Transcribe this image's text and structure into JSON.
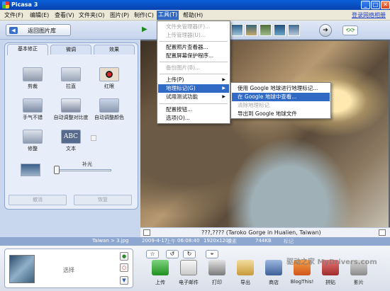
{
  "window": {
    "title": "Picasa 3",
    "minimize": "_",
    "maximize": "□",
    "close": "✕"
  },
  "menubar": {
    "items": [
      "文件(F)",
      "编辑(E)",
      "查看(V)",
      "文件夹(O)",
      "图片(P)",
      "制作(C)",
      "工具(T)",
      "帮助(H)"
    ],
    "login": "登录网络相册"
  },
  "toolbar": {
    "back_label": "返回图片库",
    "play": "▶",
    "next": "➔"
  },
  "left_panel": {
    "tabs": [
      "基本修正",
      "微调",
      "效果"
    ],
    "tools": [
      "剪裁",
      "拉直",
      "红眼",
      "手气不错",
      "自动调整对比度",
      "自动调整颜色",
      "修整",
      "文本"
    ],
    "text_tool_icon": "ABC",
    "fill_label": "补光",
    "fill_level": 0,
    "buttons": [
      "撤消",
      "恢复"
    ]
  },
  "caption": "???,???? (Taroko Gorge in Hualien, Taiwan)",
  "status": {
    "path": "Taiwan > 3.jpg",
    "date": "2009-4-17",
    "time_prefix": "上午",
    "time": "06:08:40",
    "dimensions": "1920x1200",
    "pixels": "像素",
    "size": "744KB",
    "geotag": "标记"
  },
  "tray": {
    "select_label": "选择",
    "actions": [
      "上传",
      "电子邮件",
      "打印",
      "导出",
      "商店",
      "BlogThis!",
      "拼贴",
      "影片"
    ]
  },
  "tools_menu": {
    "items": [
      {
        "label": "文件夹管理器(F)...",
        "disabled": true
      },
      {
        "label": "上传管理器(U)...",
        "disabled": true
      },
      {
        "label": "配置照片查看器...",
        "disabled": false
      },
      {
        "label": "配置屏幕保护程序...",
        "disabled": false
      },
      {
        "label": "备份图片(B)...",
        "disabled": true
      },
      {
        "label": "上传(P)",
        "disabled": false,
        "submenu": true
      },
      {
        "label": "地理标记(G)",
        "disabled": false,
        "submenu": true,
        "highlighted": true
      },
      {
        "label": "试用测试功能",
        "disabled": false,
        "submenu": true
      },
      {
        "label": "配置按钮...",
        "disabled": false
      },
      {
        "label": "选项(O)...",
        "disabled": false
      }
    ]
  },
  "geotag_menu": {
    "items": [
      {
        "label": "使用 Google 地球进行地理标记...",
        "disabled": false
      },
      {
        "label": "在 Google 地球中查看...",
        "disabled": false,
        "highlighted": true
      },
      {
        "label": "清除地理标记",
        "disabled": true
      },
      {
        "label": "导出到 Google 地球文件",
        "disabled": false
      }
    ]
  },
  "colors": {
    "accent": "#316ac5",
    "titlebar": "#0842b0",
    "panel": "#e7eef9"
  },
  "watermark": "驱动之家 MyDrivers.com"
}
